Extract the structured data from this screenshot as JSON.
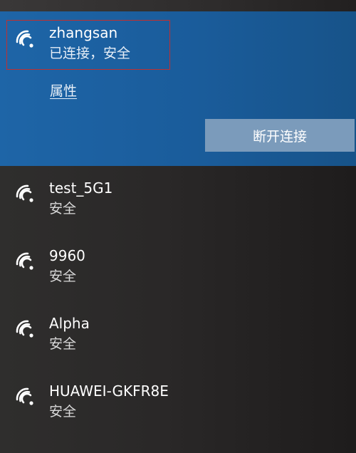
{
  "connected_network": {
    "ssid": "zhangsan",
    "status": "已连接，安全",
    "properties_link": "属性",
    "disconnect_button": "断开连接"
  },
  "networks": [
    {
      "ssid": "test_5G1",
      "status": "安全"
    },
    {
      "ssid": "9960",
      "status": "安全"
    },
    {
      "ssid": "Alpha",
      "status": "安全"
    },
    {
      "ssid": "HUAWEI-GKFR8E",
      "status": "安全"
    }
  ],
  "icons": {
    "network": "wifi-signal-icon"
  },
  "colors": {
    "connected_bg": "#1e65a7",
    "disconnect_button_bg": "#7b9bbb",
    "list_bg": "#2b2a2a",
    "focus_outline": "#c03030"
  }
}
